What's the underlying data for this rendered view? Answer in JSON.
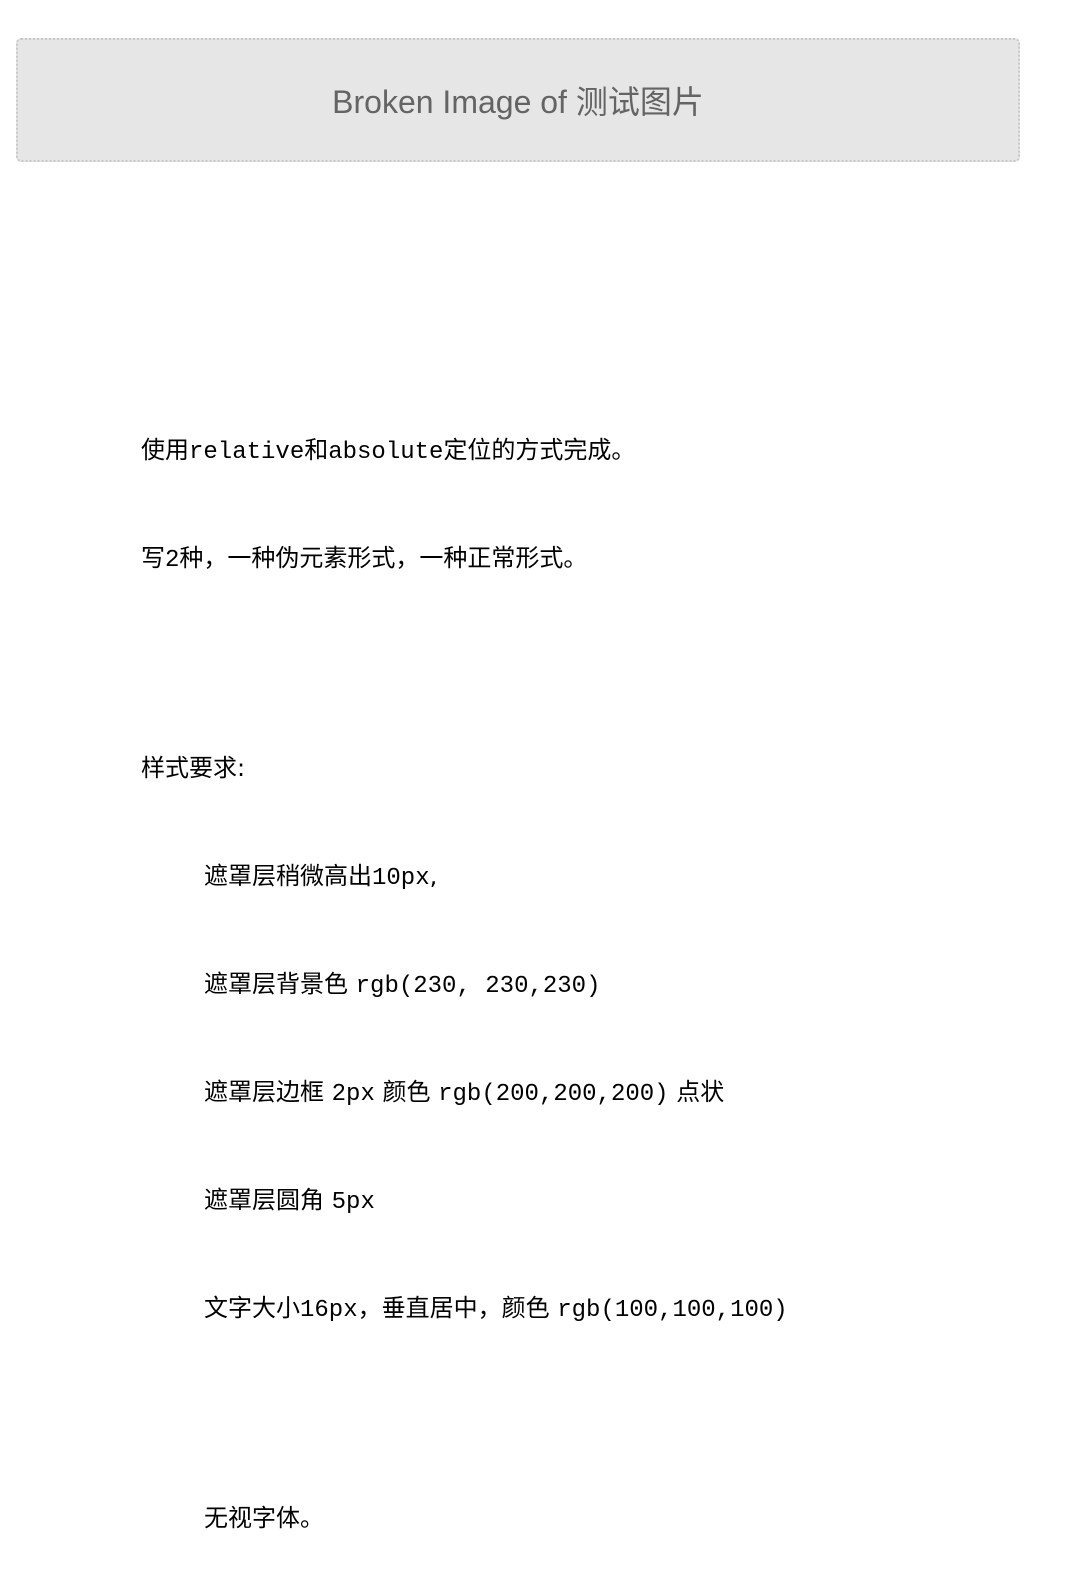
{
  "placeholder": {
    "text": "Broken Image of 测试图片"
  },
  "description": {
    "line1_a": "使用",
    "line1_b": "relative",
    "line1_c": "和",
    "line1_d": "absolute",
    "line1_e": "定位的方式完成。",
    "line2_a": "写",
    "line2_b": "2",
    "line2_c": "种，一种伪元素形式，一种正常形式。",
    "style_heading": "样式要求:",
    "req1_a": "遮罩层稍微高出",
    "req1_b": "10px",
    "req1_c": ",",
    "req2_a": "遮罩层背景色 ",
    "req2_b": "rgb(230, 230,230)",
    "req3_a": "遮罩层边框 ",
    "req3_b": "2px",
    "req3_c": " 颜色 ",
    "req3_d": "rgb(200,200,200)",
    "req3_e": " 点状",
    "req4_a": "遮罩层圆角 ",
    "req4_b": "5px",
    "req5_a": "文字大小",
    "req5_b": "16px",
    "req5_c": "，垂直居中，颜色 ",
    "req5_d": "rgb(100,100,100)",
    "note": "无视字体。"
  },
  "colors": {
    "overlay_bg": "#e6e6e6",
    "overlay_border": "#c8c8c8",
    "text": "#646464"
  }
}
